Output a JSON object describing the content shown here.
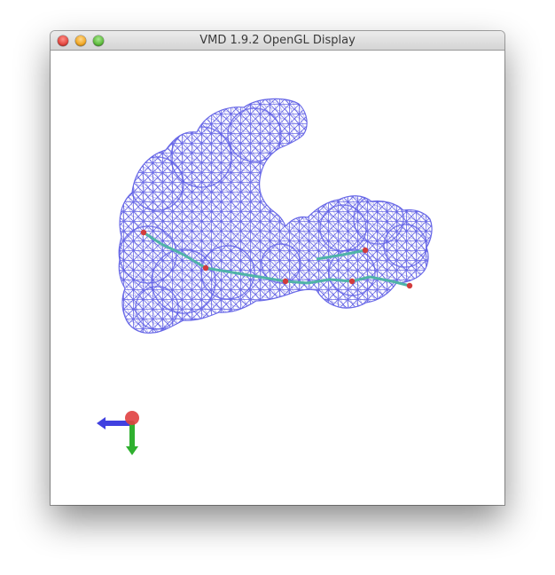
{
  "window": {
    "title": "VMD 1.9.2 OpenGL Display",
    "buttons": [
      {
        "name": "close",
        "color": "#e2463f"
      },
      {
        "name": "minimize",
        "color": "#f0a623"
      },
      {
        "name": "zoom",
        "color": "#5dbb3c"
      }
    ]
  },
  "display": {
    "background_color": "#ffffff",
    "mesh_color": "#5a5ae6",
    "molecule_colors": {
      "carbon": "#4fb3a8",
      "oxygen": "#d23c3c"
    },
    "axes": {
      "x_color": "#4040e0",
      "y_color": "#2fb02f",
      "z_color": "#e04040"
    }
  }
}
